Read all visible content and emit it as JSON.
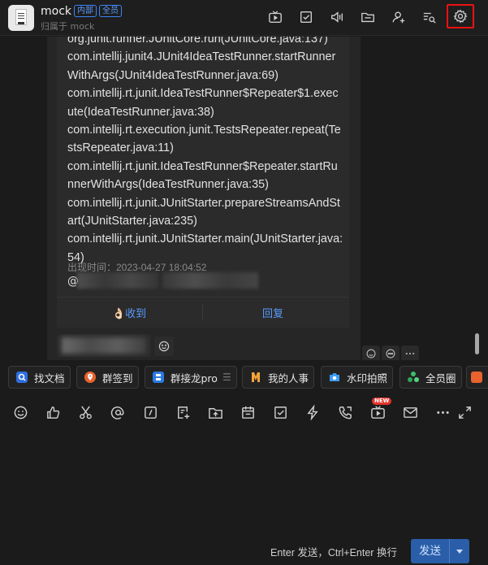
{
  "header": {
    "title": "mock",
    "badges": [
      "内部",
      "全员"
    ],
    "subtitle": "归属于 mock"
  },
  "message": {
    "stack_lines": [
      "org.junit.runner.JUnitCore.run(JUnitCore.java:137)",
      "com.intellij.junit4.JUnit4IdeaTestRunner.startRunnerWithArgs(JUnit4IdeaTestRunner.java:69)",
      "com.intellij.rt.junit.IdeaTestRunner$Repeater$1.execute(IdeaTestRunner.java:38)",
      "com.intellij.rt.execution.junit.TestsRepeater.repeat(TestsRepeater.java:11)",
      "com.intellij.rt.junit.IdeaTestRunner$Repeater.startRunnerWithArgs(IdeaTestRunner.java:35)",
      "com.intellij.rt.junit.JUnitStarter.prepareStreamsAndStart(JUnitStarter.java:235)",
      "com.intellij.rt.junit.JUnitStarter.main(JUnitStarter.java:54)"
    ],
    "time_label": "出现时间：2023-04-27 18:04:52",
    "at_symbol": "@",
    "action_received": "👌🏻收到",
    "action_reply": "回复"
  },
  "apps": [
    {
      "label": "找文档",
      "icon": "doc-search-icon",
      "color": "#3b82f6"
    },
    {
      "label": "群签到",
      "icon": "checkin-icon",
      "color": "#f0723a"
    },
    {
      "label": "群接龙pro",
      "icon": "relay-icon",
      "color": "#2f80ed"
    },
    {
      "label": "我的人事",
      "icon": "hr-icon",
      "color": "#f2a33a"
    },
    {
      "label": "水印拍照",
      "icon": "camera-icon",
      "color": "#3b9cf5"
    },
    {
      "label": "全员圈",
      "icon": "circle-icon",
      "color": "#3bbf6a"
    }
  ],
  "toolbar": {
    "new_badge": "NEW"
  },
  "composer": {
    "hint": "Enter 发送，Ctrl+Enter 换行",
    "send_label": "发送"
  },
  "colors": {
    "accent": "#5a9bff",
    "send_button": "#2a5ea8",
    "highlight_box": "#ee1111"
  }
}
